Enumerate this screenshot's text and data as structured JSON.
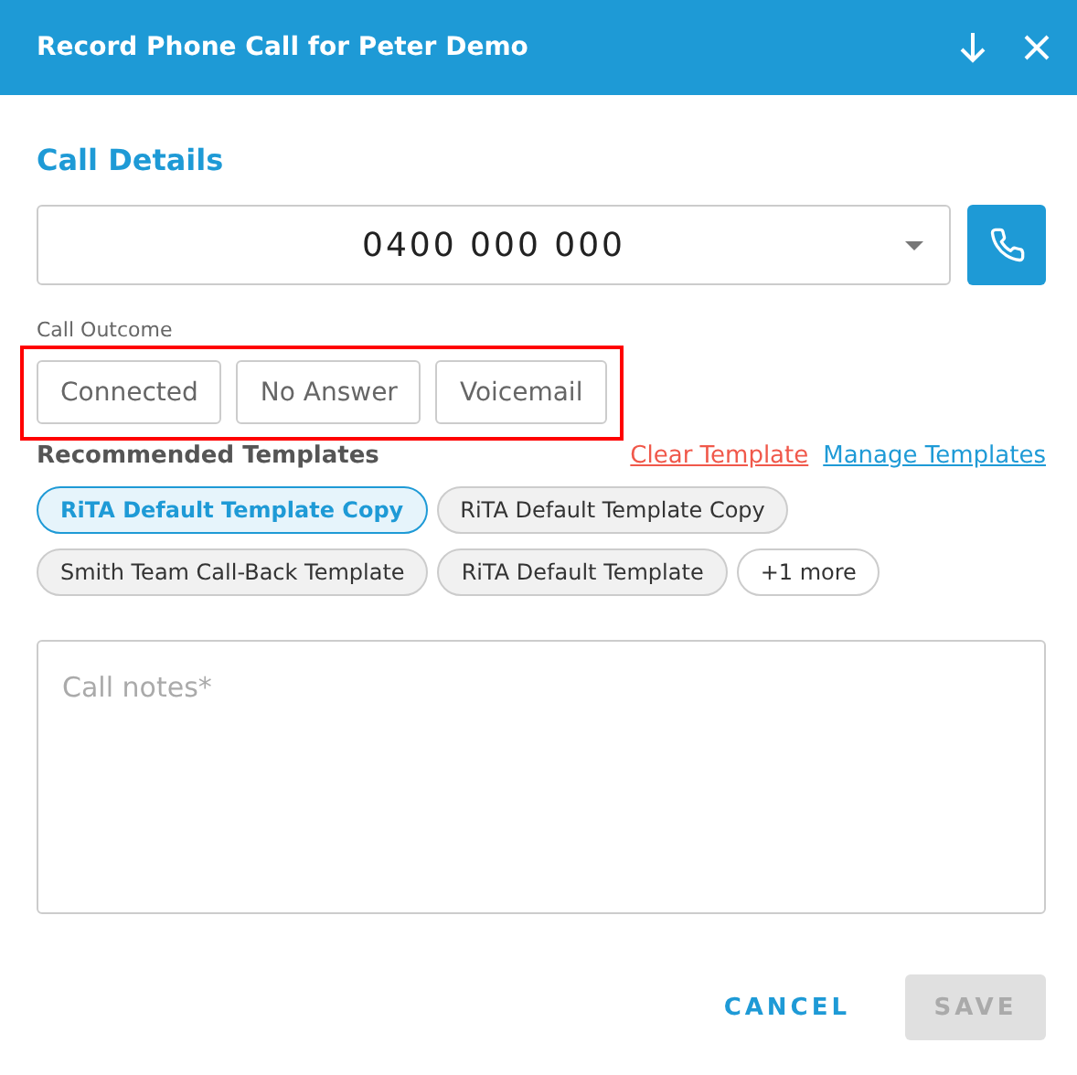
{
  "dialog": {
    "title": "Record Phone Call for Peter Demo"
  },
  "section_title": "Call Details",
  "phone_select": {
    "value": "0400 000 000"
  },
  "call_outcome": {
    "label": "Call Outcome",
    "highlighted": true,
    "options": [
      {
        "label": "Connected",
        "selected": false
      },
      {
        "label": "No Answer",
        "selected": false
      },
      {
        "label": "Voicemail",
        "selected": false
      }
    ]
  },
  "templates": {
    "label": "Recommended Templates",
    "clear_link": "Clear Template",
    "manage_link": "Manage Templates",
    "chips": [
      {
        "label": "RiTA Default Template Copy",
        "selected": true,
        "kind": "template"
      },
      {
        "label": "RiTA Default Template Copy",
        "selected": false,
        "kind": "template"
      },
      {
        "label": "Smith Team Call-Back Template",
        "selected": false,
        "kind": "template"
      },
      {
        "label": "RiTA Default Template",
        "selected": false,
        "kind": "template"
      },
      {
        "label": "+1 more",
        "selected": false,
        "kind": "more"
      }
    ]
  },
  "notes": {
    "placeholder": "Call notes*"
  },
  "actions": {
    "cancel": "CANCEL",
    "save": "SAVE",
    "save_disabled": true
  }
}
